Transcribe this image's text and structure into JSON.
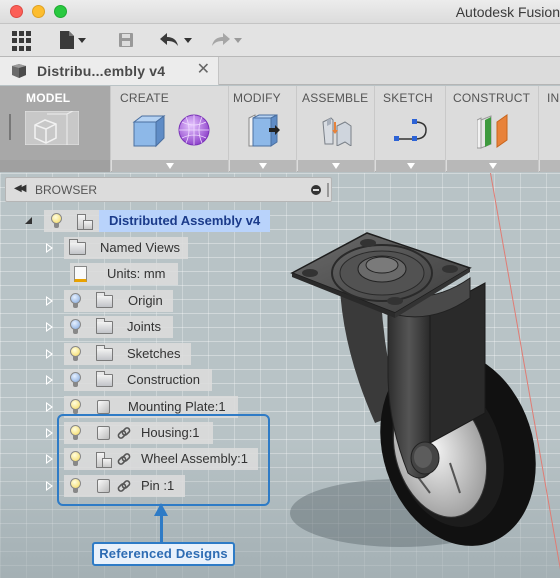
{
  "window": {
    "app_title": "Autodesk Fusion"
  },
  "toolbar": {
    "items": [
      {
        "name": "data-panel",
        "icon": "grid-icon"
      },
      {
        "name": "file-menu",
        "icon": "file-icon"
      },
      {
        "name": "save",
        "icon": "save-icon"
      },
      {
        "name": "undo",
        "icon": "undo-icon"
      },
      {
        "name": "redo",
        "icon": "redo-icon"
      }
    ]
  },
  "tabs": [
    {
      "label": "Distribu...embly v4",
      "icon": "component-box-icon",
      "close_icon": "✕"
    }
  ],
  "ribbon": {
    "workspace": "MODEL",
    "groups": [
      {
        "label": "CREATE",
        "icons": [
          "box-icon",
          "sphere-icon"
        ]
      },
      {
        "label": "MODIFY",
        "icons": [
          "press-pull-icon"
        ]
      },
      {
        "label": "ASSEMBLE",
        "icons": [
          "joint-icon"
        ]
      },
      {
        "label": "SKETCH",
        "icons": [
          "sketch-curve-icon"
        ]
      },
      {
        "label": "CONSTRUCT",
        "icons": [
          "plane-icon"
        ]
      },
      {
        "label": "IN"
      }
    ],
    "colors": {
      "create_box": "#7aa7dc",
      "sphere": "#a65de0",
      "construct_green": "#3e9a3e",
      "construct_orange": "#e8823a",
      "sketch_points": "#2d63d6"
    }
  },
  "browser": {
    "title": "BROWSER",
    "root": {
      "label": "Distributed Assembly v4",
      "visible": true
    },
    "items": [
      {
        "label": "Named Views",
        "type": "folder",
        "bulb": null,
        "expandable": true
      },
      {
        "label": "Units: mm",
        "type": "units",
        "bulb": null,
        "expandable": false
      },
      {
        "label": "Origin",
        "type": "folder",
        "bulb": "off",
        "expandable": true
      },
      {
        "label": "Joints",
        "type": "folder",
        "bulb": "off",
        "expandable": true
      },
      {
        "label": "Sketches",
        "type": "folder",
        "bulb": "on",
        "expandable": true
      },
      {
        "label": "Construction",
        "type": "folder",
        "bulb": "off",
        "expandable": true
      },
      {
        "label": "Mounting Plate:1",
        "type": "component",
        "bulb": "on",
        "expandable": true
      },
      {
        "label": "Housing:1",
        "type": "component",
        "bulb": "on",
        "expandable": true,
        "linked": true
      },
      {
        "label": "Wheel Assembly:1",
        "type": "assembly",
        "bulb": "on",
        "expandable": true,
        "linked": true
      },
      {
        "label": "Pin :1",
        "type": "component",
        "bulb": "on",
        "expandable": true,
        "linked": true
      }
    ]
  },
  "callout": {
    "label": "Referenced Designs",
    "color": "#2e7bc6"
  }
}
